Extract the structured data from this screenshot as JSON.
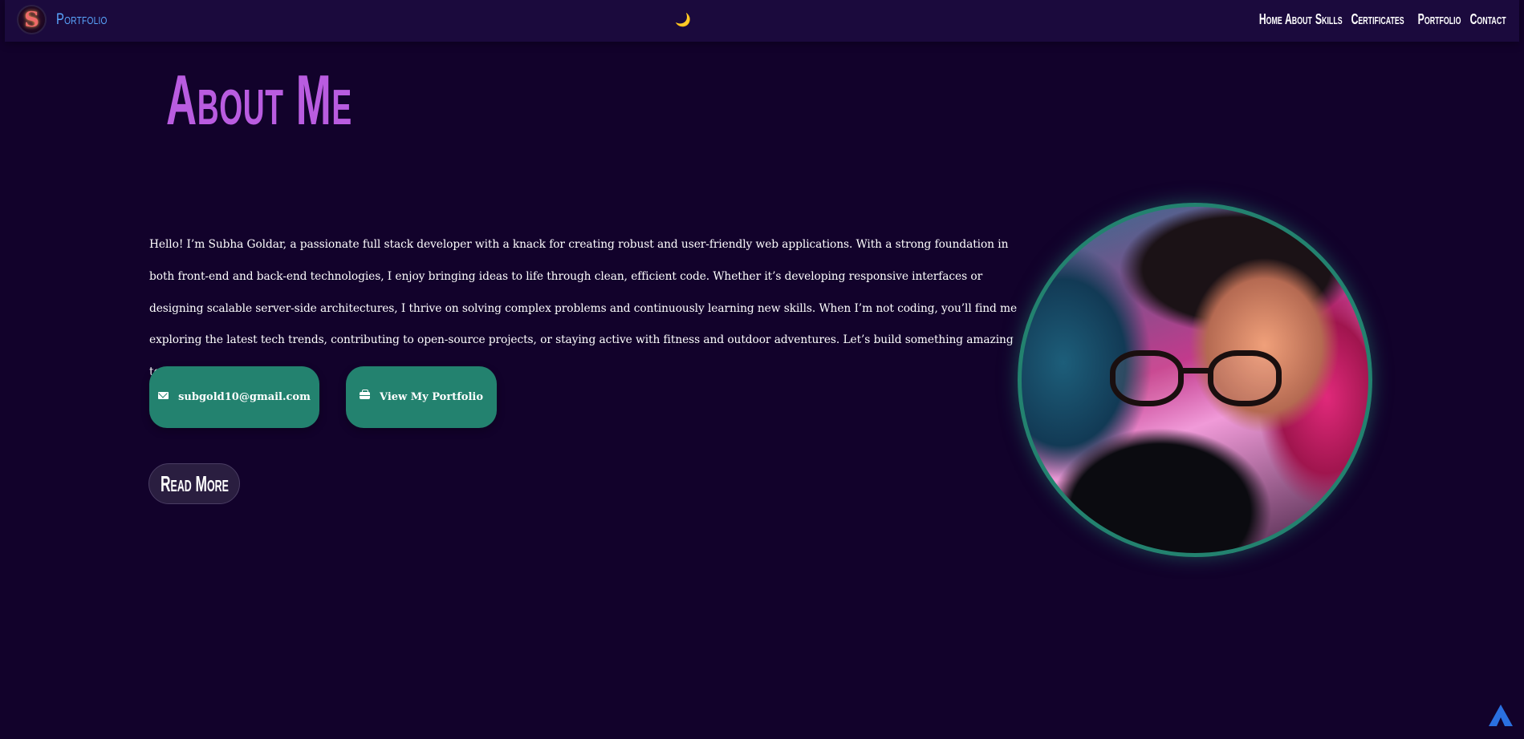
{
  "navbar": {
    "brand_logo_letter": "S",
    "brand_text": "Portfolio",
    "theme_toggle": "🌙",
    "links": [
      "Home",
      "About",
      "Skills",
      "Certificates",
      "Portfolio",
      "Contact"
    ]
  },
  "about": {
    "title": "About Me",
    "bio": "Hello! I’m Subha Goldar, a passionate full stack developer with a knack for creating robust and user-friendly web applications. With a strong foundation in both front-end and back-end technologies, I enjoy bringing ideas to life through clean, efficient code. Whether it’s developing responsive interfaces or designing scalable server-side architectures, I thrive on solving complex problems and continuously learning new skills. When I’m not coding, you’ll find me exploring the latest tech trends, contributing to open-source projects, or staying active with fitness and outdoor adventures. Let’s build something amazing together!",
    "email_button": "subgold10@gmail.com",
    "portfolio_button": "View My Portfolio",
    "read_more": "Read More"
  },
  "colors": {
    "background": "#12022b",
    "navbar": "#1b0a3d",
    "title": "#b95ce0",
    "brand": "#5aa7ff",
    "button": "#23826f",
    "scroll_top": "#2a70e0"
  },
  "icons": {
    "theme_toggle": "moon-icon",
    "email_button": "mail-icon",
    "portfolio_button": "briefcase-icon",
    "scroll_top": "arrow-up-icon"
  }
}
